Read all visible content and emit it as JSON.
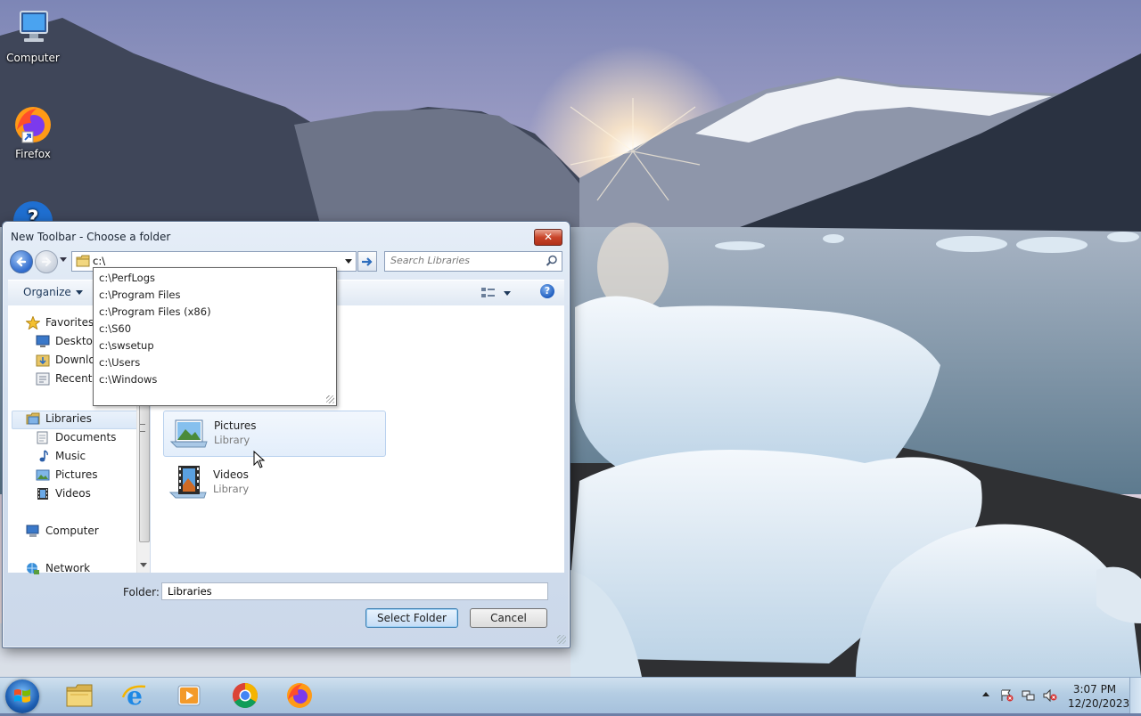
{
  "desktop": {
    "icons": [
      {
        "label": "Computer"
      },
      {
        "label": "Firefox"
      }
    ]
  },
  "dialog": {
    "title": "New Toolbar - Choose a folder",
    "close_label": "✕",
    "address_value": "c:\\",
    "search_placeholder": "Search Libraries",
    "organize_label": "Organize",
    "help_label": "?",
    "nav": {
      "favorites": "Favorites",
      "desktop": "Desktop",
      "downloads": "Downloa",
      "recent": "Recent P",
      "libraries": "Libraries",
      "documents": "Documents",
      "music": "Music",
      "pictures": "Pictures",
      "videos": "Videos",
      "computer": "Computer",
      "network": "Network"
    },
    "content": {
      "items": [
        {
          "name": "Pictures",
          "type": "Library"
        },
        {
          "name": "Videos",
          "type": "Library"
        }
      ]
    },
    "folder_label": "Folder:",
    "folder_value": "Libraries",
    "select_button": "Select Folder",
    "cancel_button": "Cancel"
  },
  "autocomplete": {
    "items": [
      "c:\\PerfLogs",
      "c:\\Program Files",
      "c:\\Program Files (x86)",
      "c:\\S60",
      "c:\\swsetup",
      "c:\\Users",
      "c:\\Windows"
    ]
  },
  "taskbar": {
    "clock_time": "3:07 PM",
    "clock_date": "12/20/2023"
  },
  "colors": {
    "accent": "#3c7fb1",
    "close_red": "#c9452a"
  }
}
